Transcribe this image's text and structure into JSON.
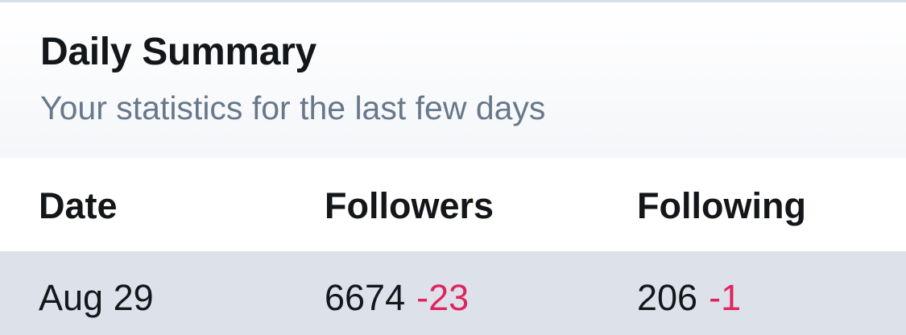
{
  "summary": {
    "title": "Daily Summary",
    "subtitle": "Your statistics for the last few days"
  },
  "table": {
    "headers": [
      "Date",
      "Followers",
      "Following"
    ],
    "rows": [
      {
        "date": "Aug 29",
        "followers": "6674",
        "followers_delta": "-23",
        "following": "206",
        "following_delta": "-1"
      }
    ]
  },
  "colors": {
    "text_primary": "#14171a",
    "text_secondary": "#67788a",
    "negative_delta": "#e0245e",
    "row_highlight": "#dde2ea"
  }
}
